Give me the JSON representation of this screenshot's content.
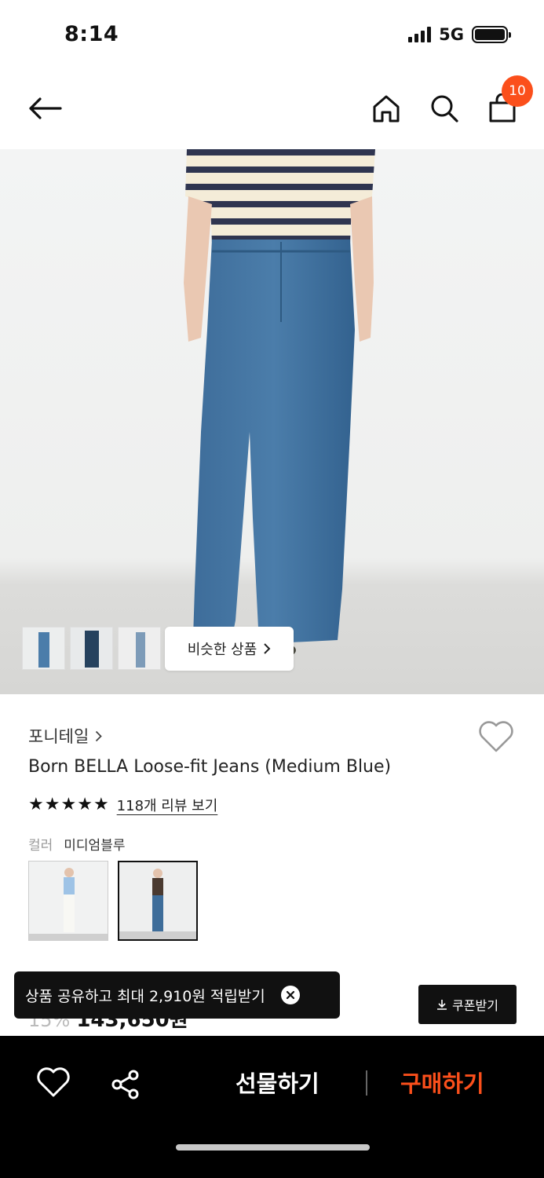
{
  "status": {
    "time": "8:14",
    "network": "5G"
  },
  "nav": {
    "cart_count": "10"
  },
  "hero": {
    "similar_label": "비슷한 상품"
  },
  "product": {
    "brand": "포니테일",
    "title": "Born BELLA Loose-fit Jeans (Medium Blue)",
    "rating_stars": 5,
    "review_link": "118개 리뷰 보기",
    "color_label": "컬러",
    "color_value": "미디엄블루",
    "swatches": [
      "white",
      "medium-blue"
    ],
    "selected_swatch": "medium-blue",
    "discount": "15%",
    "price": "143,650원"
  },
  "toast": {
    "text": "상품 공유하고 최대 2,910원 적립받기"
  },
  "coupon": {
    "label": "쿠폰받기"
  },
  "bottom": {
    "gift_label": "선물하기",
    "buy_label": "구매하기"
  },
  "colors": {
    "accent": "#fb4f1b",
    "dark": "#111111",
    "denim": "#3a6f9e"
  }
}
